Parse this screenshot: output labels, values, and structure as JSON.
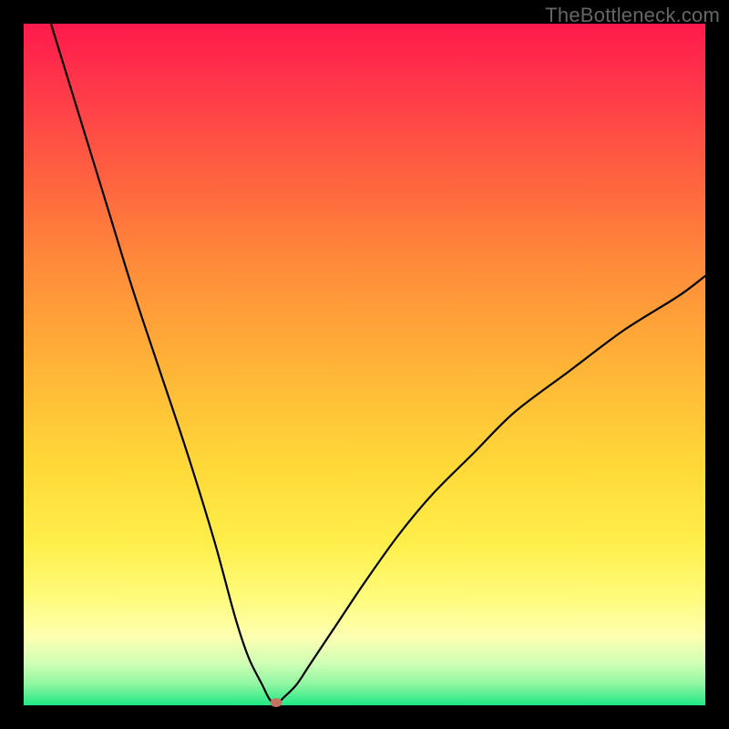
{
  "watermark": "TheBottleneck.com",
  "colors": {
    "frame": "#000000",
    "curve": "#000000",
    "marker": "#c27662",
    "watermark": "#666666"
  },
  "chart_data": {
    "type": "line",
    "title": "",
    "xlabel": "",
    "ylabel": "",
    "xlim": [
      0,
      100
    ],
    "ylim": [
      0,
      100
    ],
    "grid": false,
    "series": [
      {
        "name": "bottleneck-curve",
        "x": [
          4,
          8,
          12,
          16,
          20,
          24,
          28,
          31,
          33,
          35,
          36,
          37,
          38,
          40,
          42,
          46,
          50,
          55,
          60,
          66,
          72,
          80,
          88,
          96,
          100
        ],
        "values": [
          100,
          87,
          74,
          61,
          49,
          37,
          24,
          13,
          7,
          3,
          1,
          0,
          1,
          3,
          6,
          12,
          18,
          25,
          31,
          37,
          43,
          49,
          55,
          60,
          63
        ]
      }
    ],
    "minimum_point": {
      "x": 37,
      "y": 0
    },
    "background_gradient": {
      "direction": "top-to-bottom",
      "stops": [
        {
          "pos": 0.0,
          "color": "#ff1a4c"
        },
        {
          "pos": 0.5,
          "color": "#ffb338"
        },
        {
          "pos": 0.8,
          "color": "#fff95a"
        },
        {
          "pos": 1.0,
          "color": "#1ee885"
        }
      ]
    }
  }
}
